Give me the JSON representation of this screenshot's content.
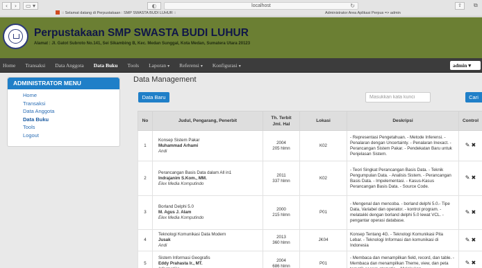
{
  "browser": {
    "url": "localhost",
    "tabs": [
      {
        "label": ":: Selamat datang di Perpustakaan : SMP SWASTA BUDI LUHUR ::"
      },
      {
        "label": "Administrator Area Aplikasi Perpus => admin"
      }
    ]
  },
  "header": {
    "title": "Perpustakaan SMP SWASTA BUDI LUHUR",
    "address": "Alamat : Jl. Gatot Subroto No.141, Sei Sikambing B, Kec. Medan Sunggal, Kota Medan, Sumatera Utara 20123"
  },
  "nav": {
    "items": [
      {
        "label": "Home",
        "dropdown": false
      },
      {
        "label": "Transaksi",
        "dropdown": false
      },
      {
        "label": "Data Anggota",
        "dropdown": false
      },
      {
        "label": "Data Buku",
        "dropdown": false,
        "active": true
      },
      {
        "label": "Tools",
        "dropdown": false
      },
      {
        "label": "Laporan",
        "dropdown": true
      },
      {
        "label": "Referensi",
        "dropdown": true
      },
      {
        "label": "Konfigurasi",
        "dropdown": true
      }
    ],
    "user_label": "admin"
  },
  "sidebar": {
    "heading": "ADMINISTRATOR MENU",
    "items": [
      {
        "label": "Home"
      },
      {
        "label": "Transaksi"
      },
      {
        "label": "Data Anggota"
      },
      {
        "label": "Data Buku",
        "active": true
      },
      {
        "label": "Tools"
      },
      {
        "label": "Logout"
      }
    ]
  },
  "main": {
    "title": "Data Management",
    "new_button": "Data Baru",
    "search_placeholder": "Masukkan kata kunci",
    "search_button": "Cari",
    "columns": {
      "no": "No",
      "judul": "Judul, Pengarang, Penerbit",
      "terbit_a": "Th. Terbit",
      "terbit_b": "Jml. Hal",
      "lokasi": "Lokasi",
      "deskripsi": "Deskripsi",
      "control": "Control"
    },
    "rows": [
      {
        "no": "1",
        "title": "Konsep Sistem Pakar",
        "author": "Muhammad Arhami",
        "publisher": "Andi",
        "year": "2004",
        "pages": "205 hlmn",
        "location": "K02",
        "description": "- Representasi Pengetahuan. - Metode Inferensi. - Penalaran dengan Uncertainty. - Penalaran Inexact. - Perancangan Sistem Pakar. - Pendekatan Baru untuk Penjelasan Sistem."
      },
      {
        "no": "2",
        "title": "Perancangan Basis Data dalam All in1",
        "author": "Indrajanim S.Kom., MM.",
        "publisher": "Elex Media Komputindo",
        "year": "2011",
        "pages": "337 hlmn",
        "location": "K02",
        "description": "- Teori Singkat Perancangan Basis Data. - Teknik Pengumpulan Data. - Analisis Sistem. - Perancangan Basis Data. - Impelementasi. - Kasus-Kasus Perancangan Basis Data. - Source Code."
      },
      {
        "no": "3",
        "title": "Borland Delphi 5.0",
        "author": "M. Agus J. Alam",
        "publisher": "Elex Media Komputindo",
        "year": "2000",
        "pages": "215 hlmn",
        "location": "P01",
        "description": "- Mengenal dan mencoba. - borland delphi 5.0.- Tipe Data, Variabel dan operator. - kontrol program. - melatakki dengan borland delphi 5.0 lewat VCL. - pengantar operasi database."
      },
      {
        "no": "4",
        "title": "Teknologi Komunikasi Data Modern",
        "author": "Jusak",
        "publisher": "Andi",
        "year": "2013",
        "pages": "360 hlmn",
        "location": "JK04",
        "description": "Konsep Tentang 4G. - Teknologi Komunikasi Pita Lebar. - Teknologi Informasi dan komunikasi di Indonesia"
      },
      {
        "no": "5",
        "title": "Sistem Informasi Geografis",
        "author": "Eddy Prahasta Ir., MT.",
        "publisher": "Informatika",
        "year": "2004",
        "pages": "686 hlmn",
        "location": "P01",
        "description": "- Membaca dan menampilkan field, record, dan table. - Membaca dan menampilkan Theme, view, dan peta tematik secara otomatis. - Melakukan"
      }
    ],
    "row_actions": {
      "edit_icon": "pencil-icon",
      "delete_icon": "close-icon"
    }
  }
}
